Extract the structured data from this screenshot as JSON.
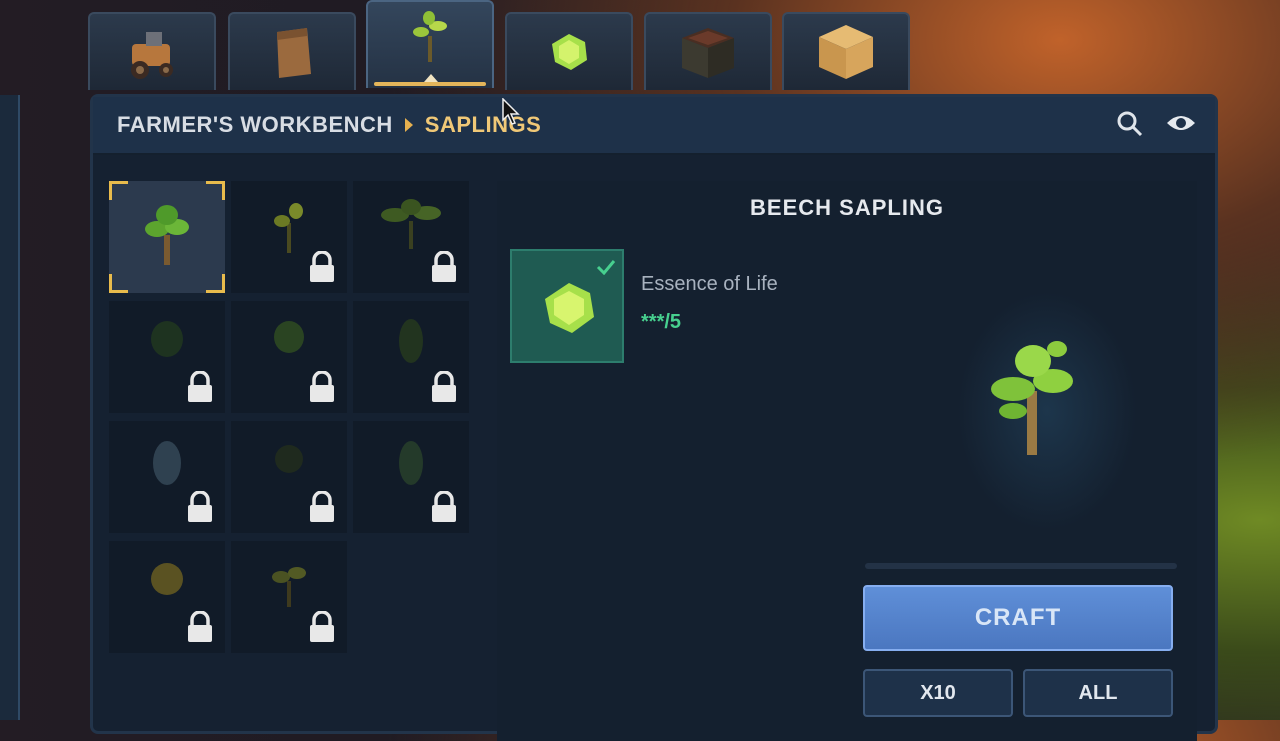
{
  "tabs": [
    {
      "icon": "tractor-icon",
      "active": false
    },
    {
      "icon": "seed-bag-icon",
      "active": false
    },
    {
      "icon": "sapling-icon",
      "active": true
    },
    {
      "icon": "essence-icon",
      "active": false
    },
    {
      "icon": "planter-box-icon",
      "active": false
    },
    {
      "icon": "hay-bale-icon",
      "active": false
    }
  ],
  "header": {
    "breadcrumb": "FARMER'S WORKBENCH",
    "current": "SAPLINGS"
  },
  "recipes": [
    {
      "locked": false,
      "selected": true
    },
    {
      "locked": true
    },
    {
      "locked": true
    },
    {
      "locked": true
    },
    {
      "locked": true
    },
    {
      "locked": true
    },
    {
      "locked": true
    },
    {
      "locked": true
    },
    {
      "locked": true
    },
    {
      "locked": true
    },
    {
      "locked": true
    }
  ],
  "detail": {
    "title": "BEECH SAPLING",
    "ingredient": {
      "name": "Essence of Life",
      "count": "***/5",
      "fulfilled": true
    }
  },
  "buttons": {
    "craft": "CRAFT",
    "x10": "X10",
    "all": "ALL"
  },
  "colors": {
    "accent": "#e8bb4c",
    "craft": "#5f8fd8",
    "ingredient_ok": "#47d08f"
  }
}
